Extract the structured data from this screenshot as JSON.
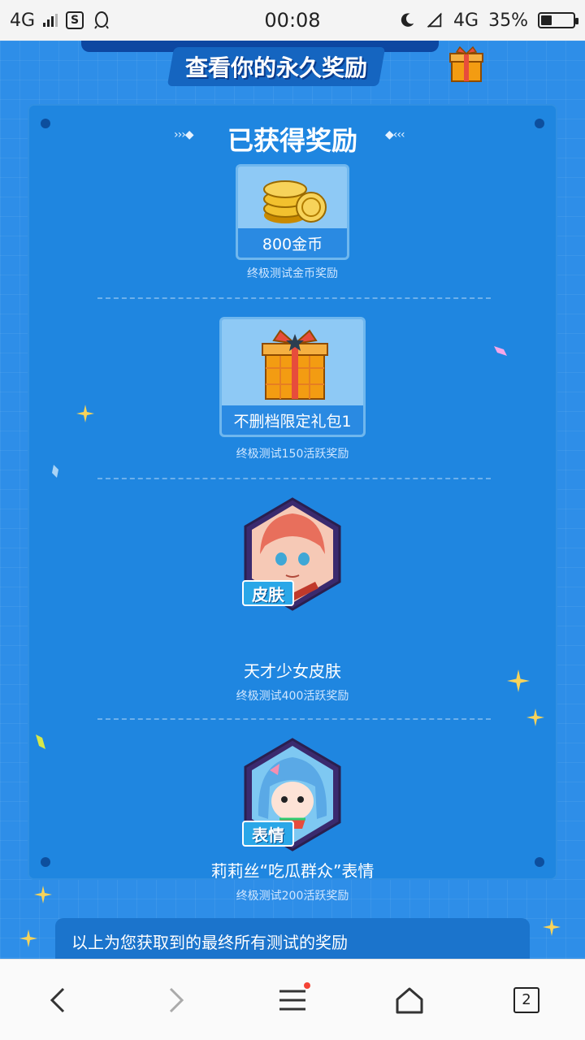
{
  "status_bar": {
    "network_left": "4G",
    "time": "00:08",
    "network_right": "4G",
    "battery": "35%",
    "battery_level": 0.35
  },
  "banner": {
    "subtitle": "查看你的永久奖励"
  },
  "rewards_panel": {
    "title": "已获得奖励",
    "items": [
      {
        "name": "800金币",
        "caption": "终极测试金币奖励",
        "icon": "gold-coins-icon"
      },
      {
        "name": "不删档限定礼包1",
        "caption": "终极测试150活跃奖励",
        "icon": "gift-box-icon"
      },
      {
        "name": "天才少女皮肤",
        "caption": "终极测试400活跃奖励",
        "tag": "皮肤",
        "icon": "character-skin-portrait"
      },
      {
        "name": "莉莉丝“吃瓜群众”表情",
        "caption": "终极测试200活跃奖励",
        "tag": "表情",
        "icon": "emoji-portrait"
      }
    ]
  },
  "info": {
    "line1": "以上为您获取到的最终所有测试的奖励"
  },
  "browser_nav": {
    "tab_count": "2"
  },
  "colors": {
    "page_bg": "#2e8ee8",
    "panel_bg": "#1f86e0",
    "card_bg": "#8ec9f5",
    "tag_bg": "#2aa7e8"
  }
}
